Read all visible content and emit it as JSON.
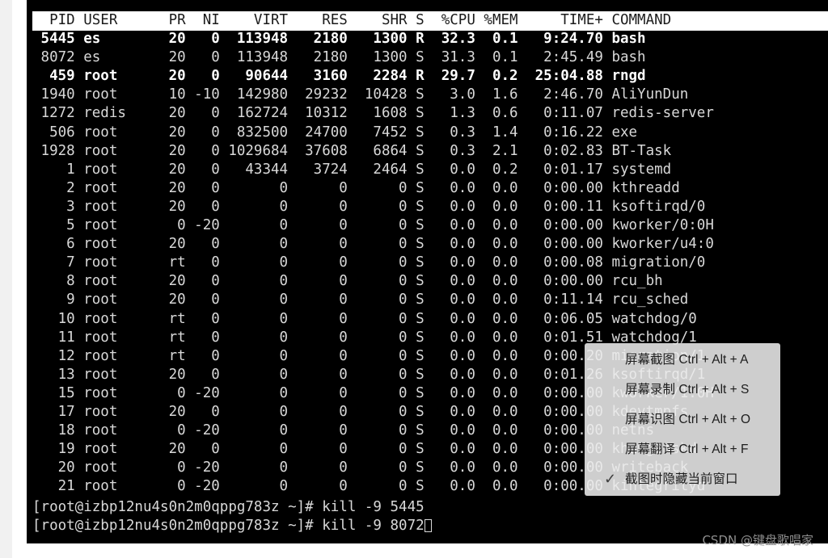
{
  "terminal": {
    "header": "  PID USER      PR  NI    VIRT    RES    SHR S  %CPU %MEM     TIME+ COMMAND",
    "rows": [
      {
        "text": " 5445 es        20   0  113948   2180   1300 R  32.3  0.1   9:24.70 bash",
        "bold": true
      },
      {
        "text": " 8072 es        20   0  113948   2180   1300 S  31.3  0.1   2:45.49 bash",
        "bold": false
      },
      {
        "text": "  459 root      20   0   90644   3160   2284 R  29.7  0.2  25:04.88 rngd",
        "bold": true
      },
      {
        "text": " 1940 root      10 -10  142980  29232  10428 S   3.0  1.6   2:46.70 AliYunDun",
        "bold": false
      },
      {
        "text": " 1272 redis     20   0  162724  10312   1608 S   1.3  0.6   0:11.07 redis-server",
        "bold": false
      },
      {
        "text": "  506 root      20   0  832500  24700   7452 S   0.3  1.4   0:16.22 exe",
        "bold": false
      },
      {
        "text": " 1928 root      20   0 1029684  37608   6864 S   0.3  2.1   0:02.83 BT-Task",
        "bold": false
      },
      {
        "text": "    1 root      20   0   43344   3724   2464 S   0.0  0.2   0:01.17 systemd",
        "bold": false
      },
      {
        "text": "    2 root      20   0       0      0      0 S   0.0  0.0   0:00.00 kthreadd",
        "bold": false
      },
      {
        "text": "    3 root      20   0       0      0      0 S   0.0  0.0   0:00.11 ksoftirqd/0",
        "bold": false
      },
      {
        "text": "    5 root       0 -20       0      0      0 S   0.0  0.0   0:00.00 kworker/0:0H",
        "bold": false
      },
      {
        "text": "    6 root      20   0       0      0      0 S   0.0  0.0   0:00.00 kworker/u4:0",
        "bold": false
      },
      {
        "text": "    7 root      rt   0       0      0      0 S   0.0  0.0   0:00.08 migration/0",
        "bold": false
      },
      {
        "text": "    8 root      20   0       0      0      0 S   0.0  0.0   0:00.00 rcu_bh",
        "bold": false
      },
      {
        "text": "    9 root      20   0       0      0      0 S   0.0  0.0   0:11.14 rcu_sched",
        "bold": false
      },
      {
        "text": "   10 root      rt   0       0      0      0 S   0.0  0.0   0:06.05 watchdog/0",
        "bold": false
      },
      {
        "text": "   11 root      rt   0       0      0      0 S   0.0  0.0   0:01.51 watchdog/1",
        "bold": false
      },
      {
        "text": "   12 root      rt   0       0      0      0 S   0.0  0.0   0:00.20 migration/1",
        "bold": false
      },
      {
        "text": "   13 root      20   0       0      0      0 S   0.0  0.0   0:01.26 ksoftirqd/1",
        "bold": false
      },
      {
        "text": "   15 root       0 -20       0      0      0 S   0.0  0.0   0:00.00 kworker/1:0H",
        "bold": false
      },
      {
        "text": "   17 root      20   0       0      0      0 S   0.0  0.0   0:00.00 kdevtmpfs",
        "bold": false
      },
      {
        "text": "   18 root       0 -20       0      0      0 S   0.0  0.0   0:00.00 netns",
        "bold": false
      },
      {
        "text": "   19 root      20   0       0      0      0 S   0.0  0.0   0:00.00 khungtaskd",
        "bold": false
      },
      {
        "text": "   20 root       0 -20       0      0      0 S   0.0  0.0   0:00.00 writeback",
        "bold": false
      },
      {
        "text": "   21 root       0 -20       0      0      0 S   0.0  0.0   0:00.00 kintegrityd",
        "bold": false
      }
    ],
    "prompt_lines": [
      {
        "text": "[root@izbp12nu4s0n2m0qppg783z ~]# kill -9 5445",
        "cursor": false
      },
      {
        "text": "[root@izbp12nu4s0n2m0qppg783z ~]# kill -9 8072",
        "cursor": true
      }
    ]
  },
  "context_menu": {
    "items": [
      {
        "label": "屏幕截图",
        "accel": "Ctrl + Alt + A",
        "check": ""
      },
      {
        "label": "屏幕录制",
        "accel": "Ctrl + Alt + S",
        "check": ""
      },
      {
        "label": "屏幕识图",
        "accel": "Ctrl + Alt + O",
        "check": ""
      },
      {
        "label": "屏幕翻译",
        "accel": "Ctrl + Alt + F",
        "check": ""
      },
      {
        "label": "截图时隐藏当前窗口",
        "accel": "",
        "check": "✓"
      }
    ]
  },
  "watermark": {
    "text": "CSDN @键盘歌唱家"
  },
  "colors": {
    "terminal_bg": "#000000",
    "terminal_fg": "#d8d8d8",
    "terminal_fg_bold": "#ffffff",
    "header_bg": "#ffffff",
    "header_fg": "#1b1b1b",
    "page_bg": "#ffffff",
    "gutter_bg": "#f1f1f1",
    "menu_bg": "#ebebeb",
    "menu_fg": "#1d1d1d",
    "watermark_fg": "#8f8f8f"
  }
}
